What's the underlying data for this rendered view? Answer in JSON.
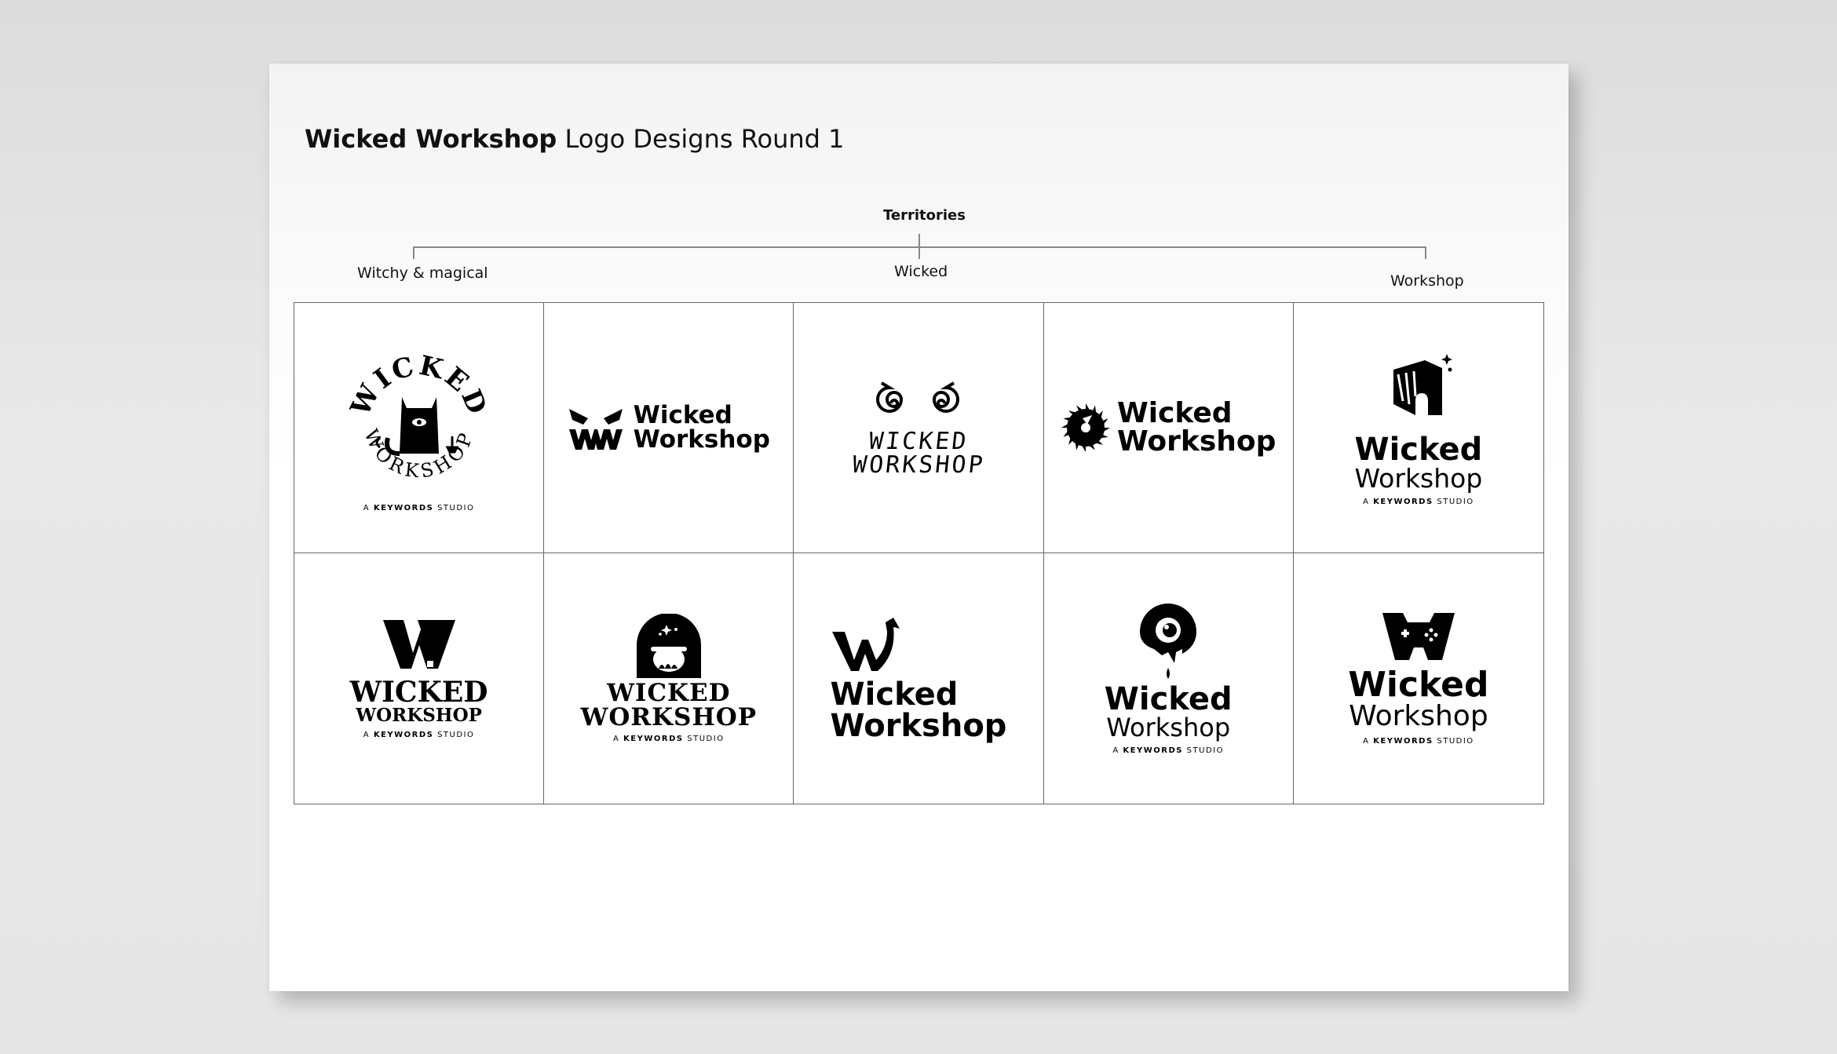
{
  "document": {
    "title_bold": "Wicked Workshop",
    "title_rest": " Logo Designs Round 1"
  },
  "territories": {
    "heading": "Territories",
    "labels": [
      "Witchy & magical",
      "Wicked",
      "Workshop"
    ]
  },
  "logos": {
    "brand_line1": "Wicked",
    "brand_line2": "Workshop",
    "brand_upper1": "WICKED",
    "brand_upper2": "WORKSHOP",
    "sub_prefix": "A ",
    "sub_bold": "KEYWORDS",
    "sub_suffix": " STUDIO",
    "circle_top": "WICKED",
    "circle_bottom": "WORKSHOP",
    "rune1": "WICKED",
    "rune2": "WORKSHOP"
  },
  "icons": {
    "cat": "cat-emblem-icon",
    "eyes": "angry-eyes-icon",
    "spirals": "spiral-eyes-icon",
    "saw": "saw-blade-icon",
    "box": "sparkle-box-icon",
    "w_letter": "w-letter-icon",
    "cauldron": "cauldron-arch-icon",
    "devil_w": "devil-tail-w-icon",
    "eyeball": "dripping-eyeball-icon",
    "gamepad_w": "gamepad-w-icon"
  },
  "colors": {
    "ink": "#000000",
    "paper": "#ffffff",
    "background": "#e6e6e7",
    "rule": "#666666"
  }
}
